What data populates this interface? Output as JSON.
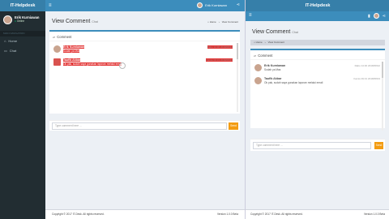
{
  "app": {
    "brand": "IT-Helpdesk"
  },
  "header": {
    "user_name": "Erik Kurniawan"
  },
  "sidebar": {
    "user_name": "Erik Kurniawan",
    "status": "Online",
    "section": "MAIN NAVIGATION",
    "items": [
      {
        "label": "Home"
      },
      {
        "label": "Chat"
      }
    ]
  },
  "page": {
    "title": "View Comment",
    "subtitle": "Chat"
  },
  "breadcrumb": {
    "home": "Home",
    "current": "View Comment"
  },
  "comments": {
    "title": "Comment",
    "items": [
      {
        "name": "Erik Kurniawan",
        "text": "Sudah ya Mas",
        "date": "Rabu 14:30 2018/08/22"
      },
      {
        "name": "Taufik Akbar",
        "text": "Ok pak, sudah saya gunakan laporan melalui email",
        "date": "Kamis 09:31 2018/08/23"
      }
    ]
  },
  "input": {
    "placeholder": "Type comment here ...",
    "button": "Send"
  },
  "footer": {
    "left": "Copyright © 2017 IT-Desk. All rights reserved.",
    "right": "Version 1.0.0 Beta"
  },
  "colors": {
    "header": "#3c8dbc",
    "logo": "#367fa9",
    "sidebar": "#222d32",
    "highlight": "#e23232",
    "send": "#f39c12"
  }
}
